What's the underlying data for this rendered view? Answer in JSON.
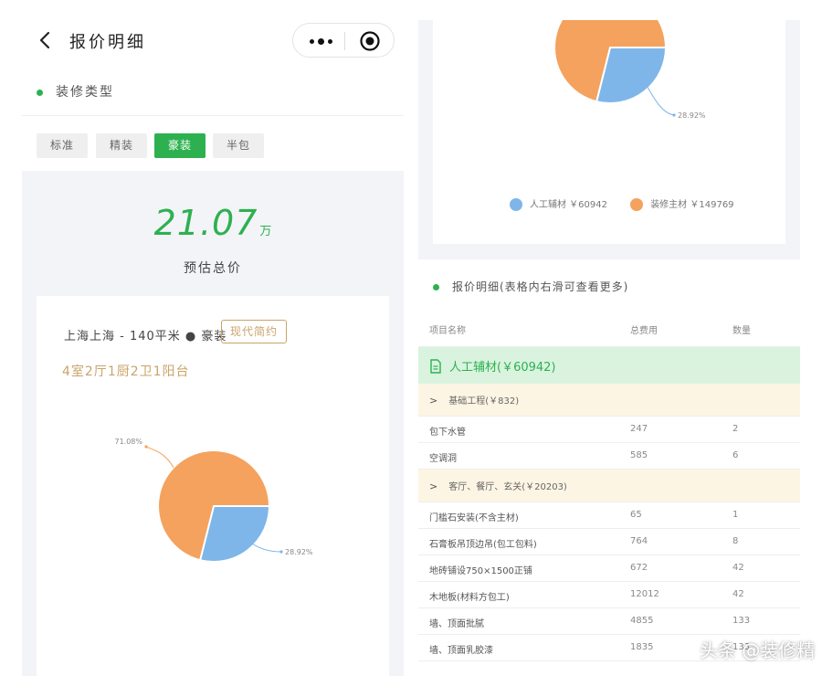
{
  "header": {
    "title": "报价明细",
    "back_icon": "chevron-left-icon",
    "more_icon": "more-dots-icon",
    "close_icon": "target-icon"
  },
  "decoration_type": {
    "label": "装修类型",
    "options": [
      "标准",
      "精装",
      "豪装",
      "半包"
    ],
    "selected": "豪装"
  },
  "summary": {
    "total_value": "21.07",
    "total_unit": "万",
    "total_label": "预估总价"
  },
  "project": {
    "location": "上海上海 - 140平米 ● 豪装",
    "style_tag": "现代简约",
    "rooms": "4室2厅1厨2卫1阳台"
  },
  "chart_data": {
    "type": "pie",
    "slices": [
      {
        "name": "人工辅材",
        "amount": 60942,
        "percent": 28.92,
        "color": "#7fb6e9"
      },
      {
        "name": "装修主材",
        "amount": 149769,
        "percent": 71.08,
        "color": "#f4a25d"
      }
    ],
    "slice_labels": [
      "71.08%",
      "28.92%"
    ],
    "legend": [
      "人工辅材 ￥60942",
      "装修主材 ￥149769"
    ],
    "legend_position": "bottom"
  },
  "detail": {
    "title": "报价明细(表格内右滑可查看更多)",
    "columns": [
      "项目名称",
      "总费用",
      "数量"
    ],
    "group": {
      "label": "人工辅材(￥60942)",
      "icon": "document-icon"
    },
    "subgroups": [
      {
        "label": "基础工程(￥832)",
        "rows": [
          {
            "name": "包下水管",
            "cost": "247",
            "qty": "2"
          },
          {
            "name": "空调洞",
            "cost": "585",
            "qty": "6"
          }
        ]
      },
      {
        "label": "客厅、餐厅、玄关(￥20203)",
        "rows": [
          {
            "name": "门槛石安装(不含主材)",
            "cost": "65",
            "qty": "1"
          },
          {
            "name": "石膏板吊顶边吊(包工包料)",
            "cost": "764",
            "qty": "8"
          },
          {
            "name": "地砖铺设750×1500正铺",
            "cost": "672",
            "qty": "42"
          },
          {
            "name": "木地板(材料方包工)",
            "cost": "12012",
            "qty": "42"
          },
          {
            "name": "墙、顶面批腻",
            "cost": "4855",
            "qty": "133"
          },
          {
            "name": "墙、顶面乳胶漆",
            "cost": "1835",
            "qty": "133"
          }
        ]
      }
    ]
  },
  "watermark": "头条 @装修精"
}
